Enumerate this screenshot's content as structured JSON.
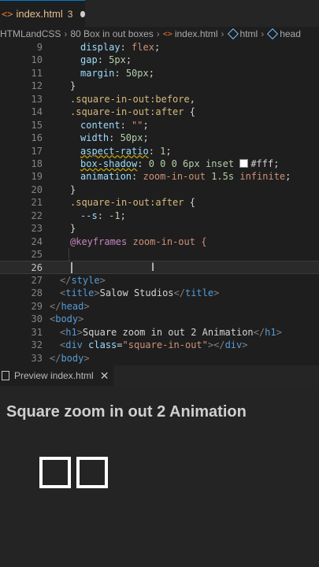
{
  "tab": {
    "icon": "<>",
    "filename": "index.html",
    "problem_count": "3"
  },
  "breadcrumb": {
    "folder1": "HTMLandCSS",
    "folder2": "80 Box in out boxes",
    "file": "index.html",
    "node1": "html",
    "node2": "head"
  },
  "editor": {
    "lines": [
      {
        "num": "9",
        "p": "display",
        "v": "flex"
      },
      {
        "num": "10",
        "p": "gap",
        "n": "5px"
      },
      {
        "num": "11",
        "p": "margin",
        "n": "50px"
      },
      {
        "num": "12",
        "text": "}"
      },
      {
        "num": "13",
        "sel": ".square-in-out",
        "pseudo": ":before",
        "tail": ","
      },
      {
        "num": "14",
        "sel": ".square-in-out",
        "pseudo": ":after",
        "tail": " {"
      },
      {
        "num": "15",
        "p": "content",
        "v": "\"\""
      },
      {
        "num": "16",
        "p": "width",
        "n": "50px"
      },
      {
        "num": "17",
        "p": "aspect-ratio",
        "n": "1"
      },
      {
        "num": "18",
        "p": "box-shadow",
        "n1": "0 0 0 6px",
        "kw": "inset",
        "color": "#fff"
      },
      {
        "num": "19",
        "p": "animation",
        "v1": "zoom-in-out",
        "n": "1.5s",
        "v2": "infinite"
      },
      {
        "num": "20",
        "text": "}"
      },
      {
        "num": "21",
        "sel": ".square-in-out",
        "pseudo": ":after",
        "tail": " {"
      },
      {
        "num": "22",
        "p": "--s",
        "n": "-1"
      },
      {
        "num": "23",
        "text": "}"
      },
      {
        "num": "24",
        "at": "@keyframes",
        "name": "zoom-in-out",
        "tail": "{"
      },
      {
        "num": "25"
      },
      {
        "num": "26"
      },
      {
        "num": "27",
        "close_tag": "style"
      },
      {
        "num": "28",
        "open": "title",
        "content": "Salow Studios",
        "close": "title"
      },
      {
        "num": "29",
        "close_tag": "head"
      },
      {
        "num": "30",
        "open_tag": "body"
      },
      {
        "num": "31",
        "open": "h1",
        "content": "Square zoom in out 2 Animation",
        "close": "h1"
      },
      {
        "num": "32",
        "tag": "div",
        "attr": "class",
        "attr_val": "\"square-in-out\""
      },
      {
        "num": "33",
        "close_tag": "body"
      }
    ]
  },
  "preview": {
    "tab_label": "Preview index.html",
    "heading": "Square zoom in out 2 Animation"
  }
}
